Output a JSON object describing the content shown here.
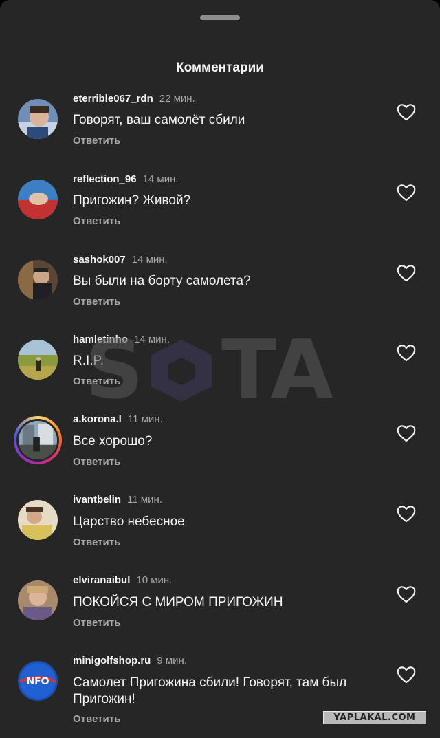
{
  "sheet": {
    "title": "Комментарии"
  },
  "reply_label": "Ответить",
  "comments": [
    {
      "user": "eterrible067_rdn",
      "time": "22 мин.",
      "text": "Говорят, ваш самолёт сбили"
    },
    {
      "user": "reflection_96",
      "time": "14 мин.",
      "text": "Пригожин? Живой?"
    },
    {
      "user": "sashok007",
      "time": "14 мин.",
      "text": "Вы были на борту самолета?"
    },
    {
      "user": "hamletinho",
      "time": "14 мин.",
      "text": "R.I.P."
    },
    {
      "user": "a.korona.l",
      "time": "11 мин.",
      "text": "Все хорошо?"
    },
    {
      "user": "ivantbelin",
      "time": "11 мин.",
      "text": "Царство небесное"
    },
    {
      "user": "elviranaibul",
      "time": "10 мин.",
      "text": "ПОКОЙСЯ С МИРОМ ПРИГОЖИН"
    },
    {
      "user": "minigolfshop.ru",
      "time": "9 мин.",
      "text": "Самолет Пригожина сбили! Говорят, там был Пригожин!"
    }
  ],
  "watermark": {
    "text": "SOTA",
    "badge": "YAPLAKAL.COM"
  },
  "avatar_logo_text": "NFO"
}
